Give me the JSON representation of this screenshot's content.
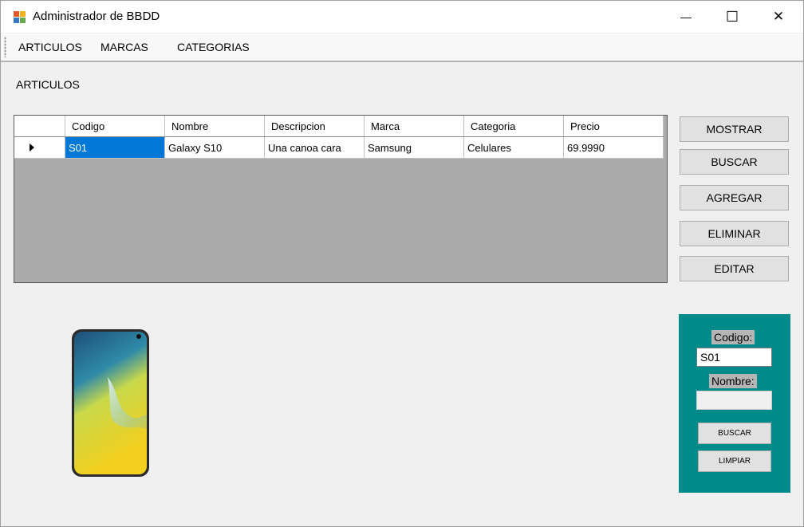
{
  "window": {
    "title": "Administrador de BBDD",
    "minimize_glyph": "—",
    "maximize_glyph": "☐",
    "close_glyph": "✕"
  },
  "menu": {
    "items": [
      {
        "label": "ARTICULOS"
      },
      {
        "label": "MARCAS"
      },
      {
        "label": "CATEGORIAS"
      }
    ]
  },
  "main": {
    "section_label": "ARTICULOS"
  },
  "grid": {
    "columns": [
      "Codigo",
      "Nombre",
      "Descripcion",
      "Marca",
      "Categoria",
      "Precio"
    ],
    "rows": [
      {
        "cells": [
          "S01",
          "Galaxy S10",
          "Una canoa cara",
          "Samsung",
          "Celulares",
          "69.9990"
        ]
      }
    ]
  },
  "actions": {
    "mostrar": "MOSTRAR",
    "buscar": "BUSCAR",
    "agregar": "AGREGAR",
    "eliminar": "ELIMINAR",
    "editar": "EDITAR"
  },
  "search_panel": {
    "codigo_label": "Codigo:",
    "codigo_value": "S01",
    "nombre_label": "Nombre:",
    "nombre_value": "",
    "buscar_label": "BUSCAR",
    "limpiar_label": "LIMPIAR"
  },
  "colors": {
    "panel_bg": "#008b8b",
    "selection": "#0078d7",
    "grid_bg": "#ababab"
  },
  "icons": {
    "app": "database-app-icon",
    "row_indicator": "row-pointer-icon"
  }
}
